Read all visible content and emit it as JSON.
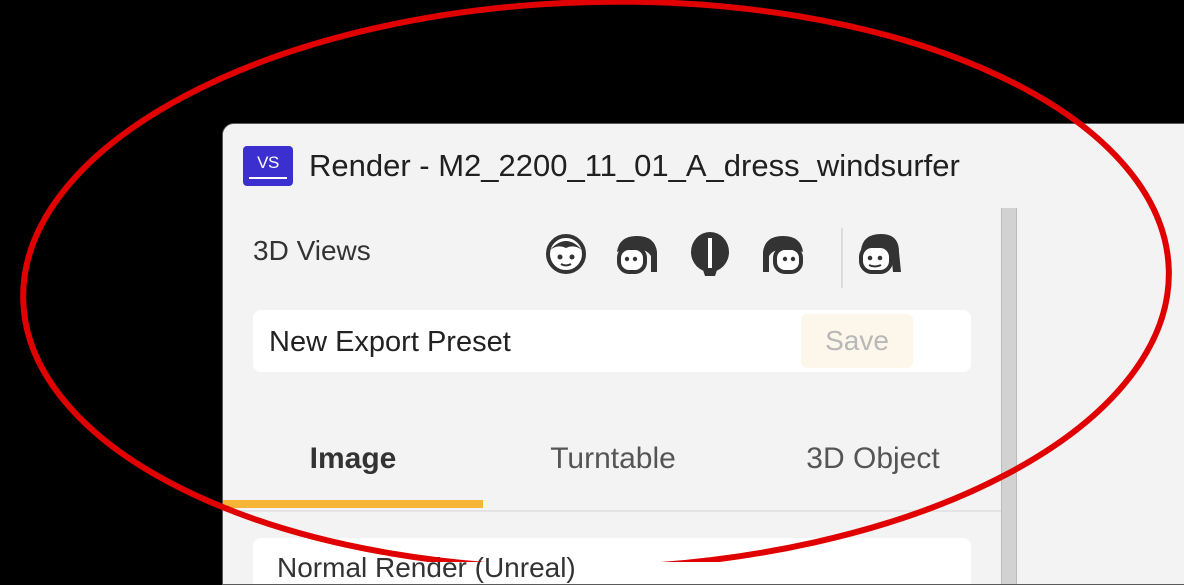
{
  "window": {
    "app_logo_text": "VS",
    "title": "Render - M2_2200_11_01_A_dress_windsurfer"
  },
  "views": {
    "label": "3D Views",
    "icons": [
      "view-front-icon",
      "view-left-icon",
      "view-back-icon",
      "view-right-icon",
      "view-three-quarter-icon"
    ]
  },
  "preset": {
    "value": "New Export Preset",
    "save_label": "Save"
  },
  "tabs": [
    {
      "label": "Image",
      "active": true
    },
    {
      "label": "Turntable",
      "active": false
    },
    {
      "label": "3D Object",
      "active": false
    }
  ],
  "render_mode": "Normal Render (Unreal)",
  "colors": {
    "accent": "#f7b538",
    "logo": "#3b2fd0",
    "annotation": "#e00000"
  }
}
